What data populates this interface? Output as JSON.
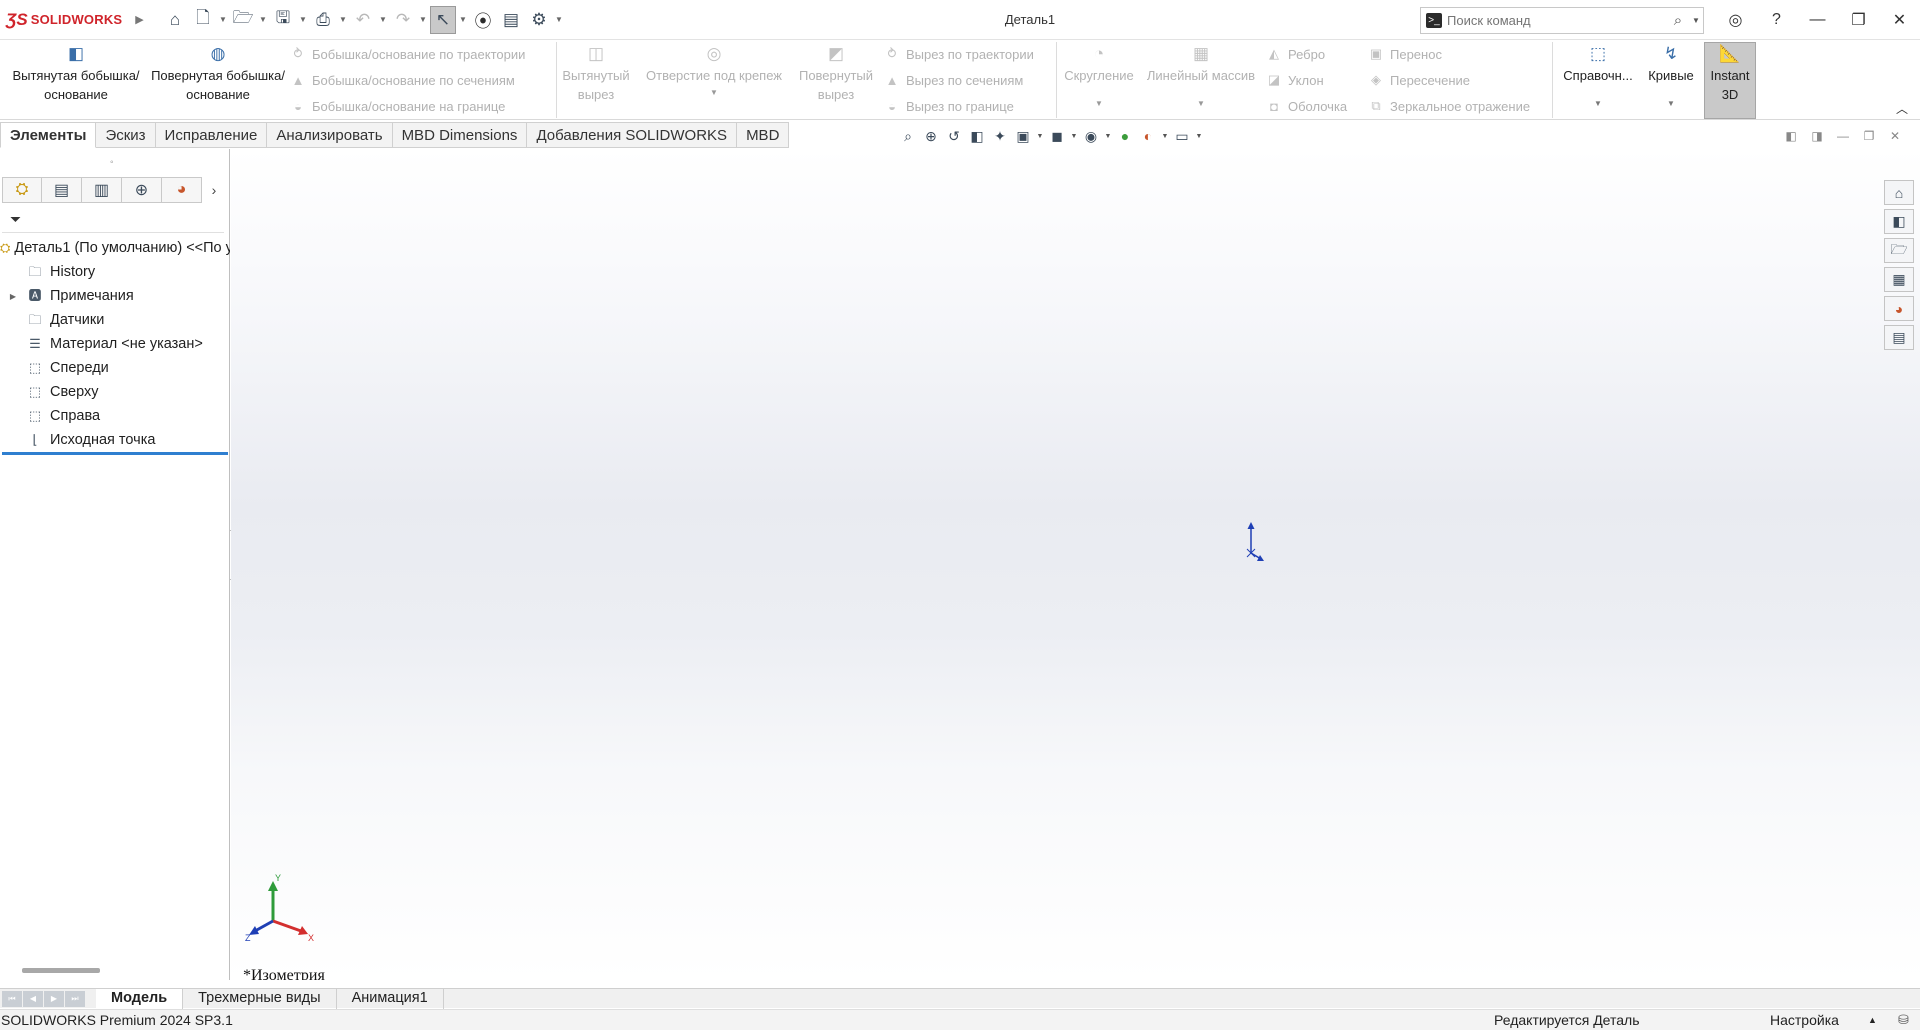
{
  "app": {
    "logo_mark": "ƷS",
    "logo_text": "SOLIDWORKS",
    "document_title": "Деталь1"
  },
  "search": {
    "placeholder": "Поиск команд"
  },
  "ribbon": {
    "extruded_boss": "Вытянутая бобышка/основание",
    "revolved_boss": "Повернутая бобышка/основание",
    "swept_boss": "Бобышка/основание по траектории",
    "lofted_boss": "Бобышка/основание по сечениям",
    "boundary_boss": "Бобышка/основание на границе",
    "extruded_cut": "Вытянутый вырез",
    "hole_wizard": "Отверстие под крепеж",
    "revolved_cut": "Повернутый вырез",
    "swept_cut": "Вырез по траектории",
    "lofted_cut": "Вырез по сечениям",
    "boundary_cut": "Вырез по границе",
    "fillet": "Скругление",
    "linear_pattern": "Линейный массив",
    "rib": "Ребро",
    "draft": "Уклон",
    "shell": "Оболочка",
    "move": "Перенос",
    "intersect": "Пересечение",
    "mirror": "Зеркальное отражение",
    "reference": "Справочн...",
    "curves": "Кривые",
    "instant3d": "Instant 3D"
  },
  "tabs": [
    "Элементы",
    "Эскиз",
    "Исправление",
    "Анализировать",
    "MBD Dimensions",
    "Добавления SOLIDWORKS",
    "MBD"
  ],
  "tree": {
    "root": "Деталь1  (По умолчанию) <<По у",
    "items": [
      "History",
      "Примечания",
      "Датчики",
      "Материал <не указан>",
      "Спереди",
      "Сверху",
      "Справа",
      "Исходная точка"
    ]
  },
  "viewport": {
    "view_name": "*Изометрия",
    "axis_x": "X",
    "axis_y": "Y",
    "axis_z": "Z"
  },
  "bottom_tabs": [
    "Модель",
    "Трехмерные виды",
    "Анимация1"
  ],
  "status": {
    "version": "SOLIDWORKS Premium 2024 SP3.1",
    "editing": "Редактируется Деталь",
    "settings": "Настройка"
  },
  "colors": {
    "brand_red": "#d0242b",
    "tree_selection": "#2f7fd0",
    "axis_x": "#d32f2f",
    "axis_y": "#2e9b3a",
    "axis_z": "#1f3fb5"
  }
}
